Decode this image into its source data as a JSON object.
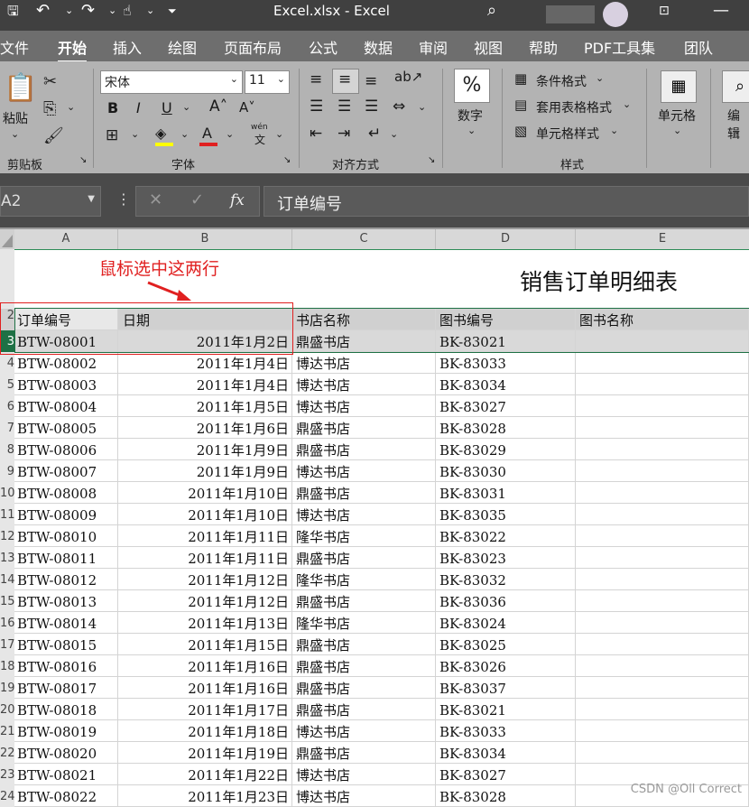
{
  "titlebar": {
    "title": "Excel.xlsx  -  Excel"
  },
  "tabs": [
    "文件",
    "开始",
    "插入",
    "绘图",
    "页面布局",
    "公式",
    "数据",
    "审阅",
    "视图",
    "帮助",
    "PDF工具集",
    "团队"
  ],
  "active_tab": "开始",
  "ribbon": {
    "paste": "粘贴",
    "font_name": "宋体",
    "font_size": "11",
    "wen": "wén",
    "wen_char": "文",
    "number_label": "数字",
    "number_symbol": "%",
    "conditional_format": "条件格式",
    "table_format": "套用表格格式",
    "cell_style": "单元格样式",
    "cells_label": "单元格",
    "edit_label": "编辑",
    "groups": {
      "clipboard": "剪贴板",
      "font": "字体",
      "alignment": "对齐方式",
      "styles": "样式"
    }
  },
  "formula_bar": {
    "name_box": "A2",
    "fx": "fx",
    "formula": "订单编号"
  },
  "columns": [
    "A",
    "B",
    "C",
    "D",
    "E"
  ],
  "annotation": {
    "text": "鼠标选中这两行",
    "color": "#e02020"
  },
  "sheet_title": "销售订单明细表",
  "header_row": {
    "row": "2",
    "cells": [
      "订单编号",
      "日期",
      "书店名称",
      "图书编号",
      "图书名称"
    ]
  },
  "rows": [
    {
      "r": "3",
      "id": "BTW-08001",
      "date": "2011年1月2日",
      "store": "鼎盛书店",
      "book": "BK-83021"
    },
    {
      "r": "4",
      "id": "BTW-08002",
      "date": "2011年1月4日",
      "store": "博达书店",
      "book": "BK-83033"
    },
    {
      "r": "5",
      "id": "BTW-08003",
      "date": "2011年1月4日",
      "store": "博达书店",
      "book": "BK-83034"
    },
    {
      "r": "6",
      "id": "BTW-08004",
      "date": "2011年1月5日",
      "store": "博达书店",
      "book": "BK-83027"
    },
    {
      "r": "7",
      "id": "BTW-08005",
      "date": "2011年1月6日",
      "store": "鼎盛书店",
      "book": "BK-83028"
    },
    {
      "r": "8",
      "id": "BTW-08006",
      "date": "2011年1月9日",
      "store": "鼎盛书店",
      "book": "BK-83029"
    },
    {
      "r": "9",
      "id": "BTW-08007",
      "date": "2011年1月9日",
      "store": "博达书店",
      "book": "BK-83030"
    },
    {
      "r": "10",
      "id": "BTW-08008",
      "date": "2011年1月10日",
      "store": "鼎盛书店",
      "book": "BK-83031"
    },
    {
      "r": "11",
      "id": "BTW-08009",
      "date": "2011年1月10日",
      "store": "博达书店",
      "book": "BK-83035"
    },
    {
      "r": "12",
      "id": "BTW-08010",
      "date": "2011年1月11日",
      "store": "隆华书店",
      "book": "BK-83022"
    },
    {
      "r": "13",
      "id": "BTW-08011",
      "date": "2011年1月11日",
      "store": "鼎盛书店",
      "book": "BK-83023"
    },
    {
      "r": "14",
      "id": "BTW-08012",
      "date": "2011年1月12日",
      "store": "隆华书店",
      "book": "BK-83032"
    },
    {
      "r": "15",
      "id": "BTW-08013",
      "date": "2011年1月12日",
      "store": "鼎盛书店",
      "book": "BK-83036"
    },
    {
      "r": "16",
      "id": "BTW-08014",
      "date": "2011年1月13日",
      "store": "隆华书店",
      "book": "BK-83024"
    },
    {
      "r": "17",
      "id": "BTW-08015",
      "date": "2011年1月15日",
      "store": "鼎盛书店",
      "book": "BK-83025"
    },
    {
      "r": "18",
      "id": "BTW-08016",
      "date": "2011年1月16日",
      "store": "鼎盛书店",
      "book": "BK-83026"
    },
    {
      "r": "19",
      "id": "BTW-08017",
      "date": "2011年1月16日",
      "store": "鼎盛书店",
      "book": "BK-83037"
    },
    {
      "r": "20",
      "id": "BTW-08018",
      "date": "2011年1月17日",
      "store": "鼎盛书店",
      "book": "BK-83021"
    },
    {
      "r": "21",
      "id": "BTW-08019",
      "date": "2011年1月18日",
      "store": "博达书店",
      "book": "BK-83033"
    },
    {
      "r": "22",
      "id": "BTW-08020",
      "date": "2011年1月19日",
      "store": "鼎盛书店",
      "book": "BK-83034"
    },
    {
      "r": "23",
      "id": "BTW-08021",
      "date": "2011年1月22日",
      "store": "博达书店",
      "book": "BK-83027"
    },
    {
      "r": "24",
      "id": "BTW-08022",
      "date": "2011年1月23日",
      "store": "博达书店",
      "book": "BK-83028"
    }
  ],
  "watermark": "CSDN @Oll Correct"
}
